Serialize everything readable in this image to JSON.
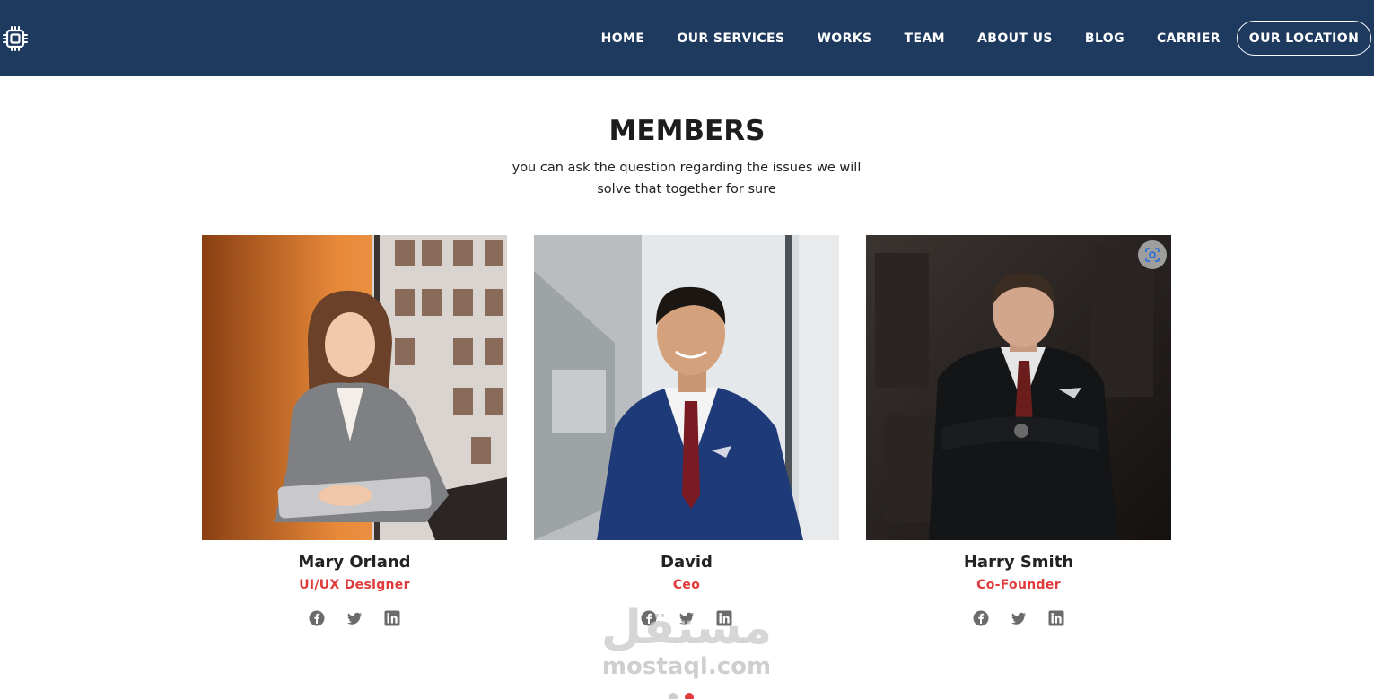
{
  "nav": {
    "logo_icon": "chip-icon",
    "links": [
      "HOME",
      "OUR SERVICES",
      "WORKS",
      "TEAM",
      "ABOUT US",
      "BLOG",
      "CARRIER"
    ],
    "location_button": "OUR LOCATION",
    "background": "#1f3a5f"
  },
  "section": {
    "title": "MEMBERS",
    "subtitle_line1": "you can ask the question regarding the issues we will",
    "subtitle_line2": "solve that together for sure"
  },
  "members": [
    {
      "name": "Mary Orland",
      "role": "UI/UX Designer",
      "photo": "woman-portrait-orange-wall"
    },
    {
      "name": "David",
      "role": "Ceo",
      "photo": "man-portrait-blue-suit"
    },
    {
      "name": "Harry Smith",
      "role": "Co-Founder",
      "photo": "man-portrait-dark-suit"
    }
  ],
  "social_icons": [
    "facebook-icon",
    "twitter-icon",
    "linkedin-icon"
  ],
  "watermark": {
    "arabic": "مستقل",
    "latin": "mostaql.com"
  },
  "accent_color": "#e03a3a"
}
